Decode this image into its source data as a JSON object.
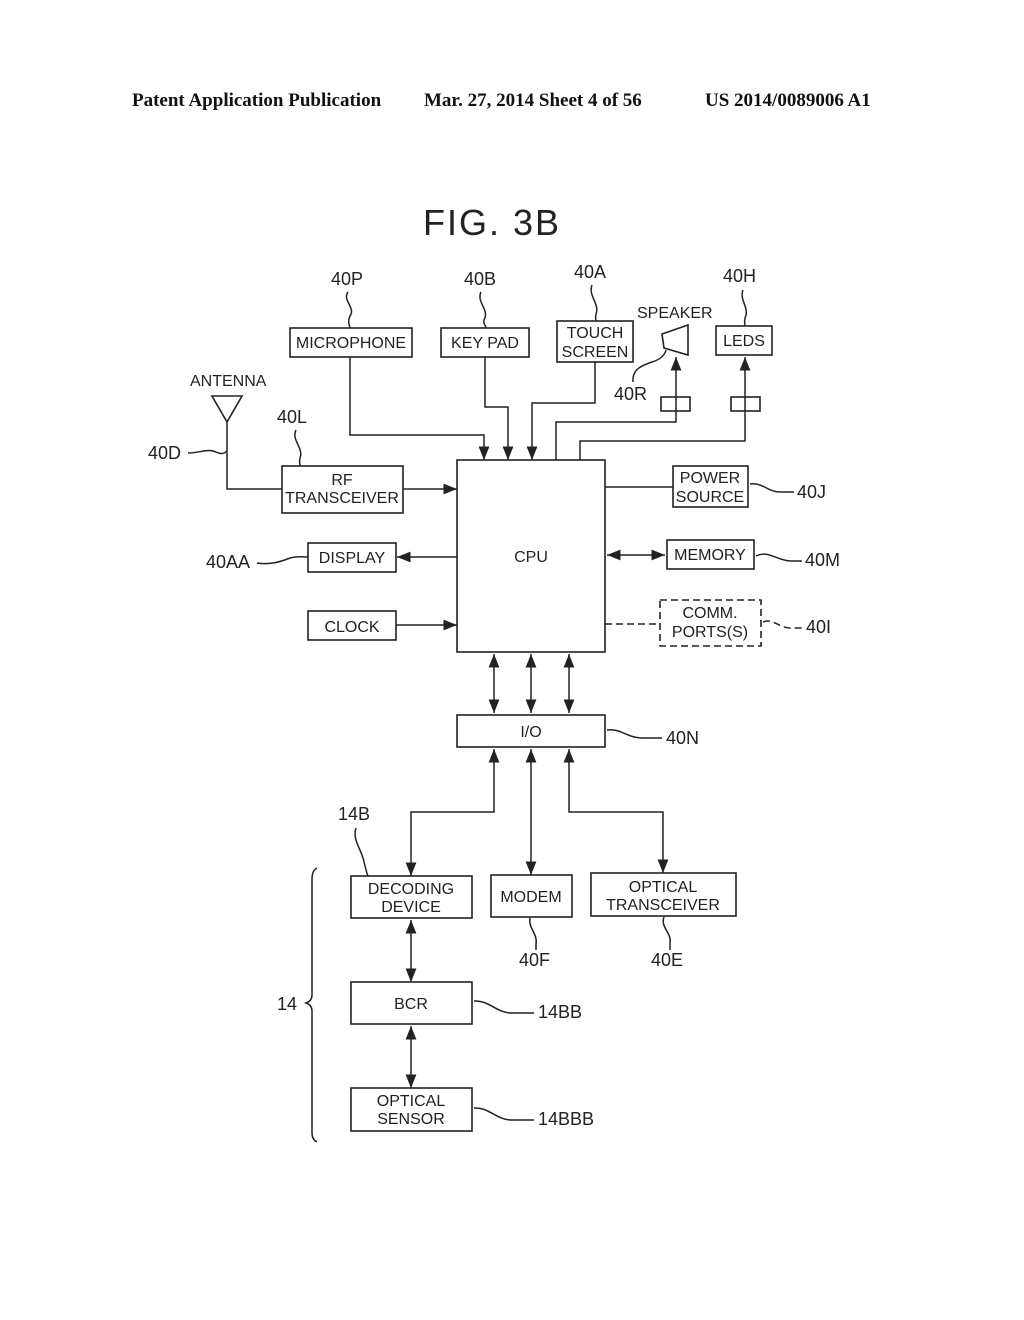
{
  "header": {
    "publication": "Patent Application Publication",
    "date_sheet": "Mar. 27, 2014  Sheet 4 of 56",
    "number": "US 2014/0089006 A1"
  },
  "figure": {
    "title": "FIG. 3B",
    "blocks": {
      "microphone": {
        "line1": "MICROPHONE",
        "ref": "40P"
      },
      "keypad": {
        "line1": "KEY  PAD",
        "ref": "40B"
      },
      "touch_screen": {
        "line1": "TOUCH",
        "line2": "SCREEN",
        "ref": "40A"
      },
      "speaker": {
        "label": "SPEAKER",
        "ref": "40R"
      },
      "leds": {
        "line1": "LEDS",
        "ref": "40H"
      },
      "antenna": {
        "label": "ANTENNA",
        "ref": "40D"
      },
      "rf_transceiver": {
        "line1": "RF",
        "line2": "TRANSCEIVER",
        "ref": "40L"
      },
      "cpu": {
        "line1": "CPU"
      },
      "power_source": {
        "line1": "POWER",
        "line2": "SOURCE",
        "ref": "40J"
      },
      "display": {
        "line1": "DISPLAY",
        "ref": "40AA"
      },
      "memory": {
        "line1": "MEMORY",
        "ref": "40M"
      },
      "clock": {
        "line1": "CLOCK"
      },
      "comm_ports": {
        "line1": "COMM.",
        "line2": "PORTS(S)",
        "ref": "40I"
      },
      "io": {
        "line1": "I/O",
        "ref": "40N"
      },
      "decoding_device": {
        "line1": "DECODING",
        "line2": "DEVICE",
        "ref": "14B"
      },
      "modem": {
        "line1": "MODEM",
        "ref": "40F"
      },
      "optical_transceiver": {
        "line1": "OPTICAL",
        "line2": "TRANSCEIVER",
        "ref": "40E"
      },
      "bcr": {
        "line1": "BCR",
        "ref": "14BB"
      },
      "optical_sensor": {
        "line1": "OPTICAL",
        "line2": "SENSOR",
        "ref": "14BBB"
      },
      "group_14": {
        "ref": "14"
      }
    }
  }
}
